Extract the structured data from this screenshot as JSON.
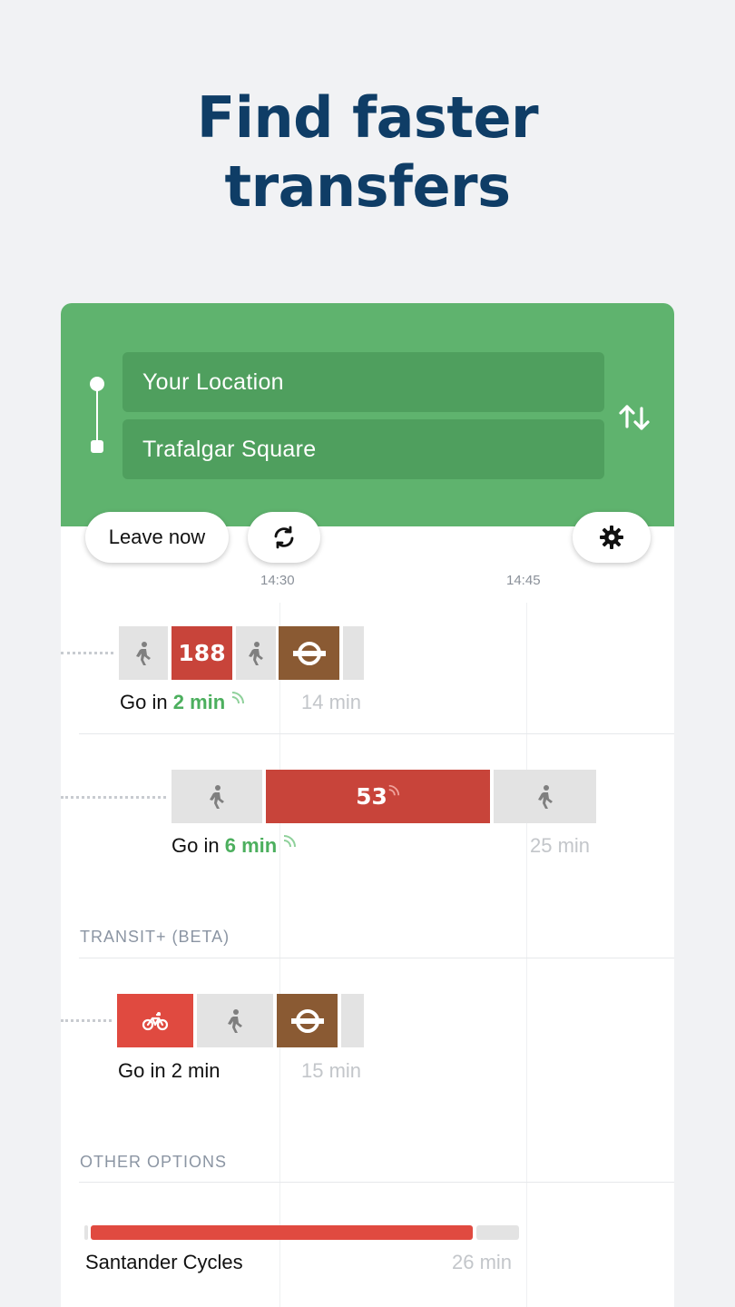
{
  "headline": {
    "line1": "Find faster",
    "line2": "transfers"
  },
  "trip": {
    "origin": "Your Location",
    "destination": "Trafalgar Square",
    "leave_label": "Leave now"
  },
  "icons": {
    "swap": "swap-arrows-icon",
    "refresh": "refresh-icon",
    "settings": "gear-icon",
    "walk": "walk-icon",
    "tube": "underground-roundel-icon",
    "cycle": "bicycle-icon",
    "realtime": "realtime-signal-icon"
  },
  "timeline": {
    "ticks": [
      "14:30",
      "14:45"
    ]
  },
  "routes": [
    {
      "bus": "188",
      "go_prefix": "Go in",
      "go_mins": "2 min",
      "duration": "14 min"
    },
    {
      "bus": "53",
      "go_prefix": "Go in",
      "go_mins": "6 min",
      "duration": "25 min"
    }
  ],
  "transit_plus": {
    "label": "TRANSIT+ (BETA)",
    "route": {
      "go_text": "Go in 2 min",
      "duration": "15 min"
    }
  },
  "other_options": {
    "label": "OTHER OPTIONS",
    "route": {
      "name": "Santander Cycles",
      "duration": "26 min"
    }
  },
  "colors": {
    "header_green": "#5fb36e",
    "field_green": "#4f9f5e",
    "bus_red": "#c8443a",
    "tube_brown": "#8a5a33",
    "cycle_red": "#e04a40",
    "realtime_green": "#4caf5e",
    "headline_navy": "#0f3d66"
  }
}
